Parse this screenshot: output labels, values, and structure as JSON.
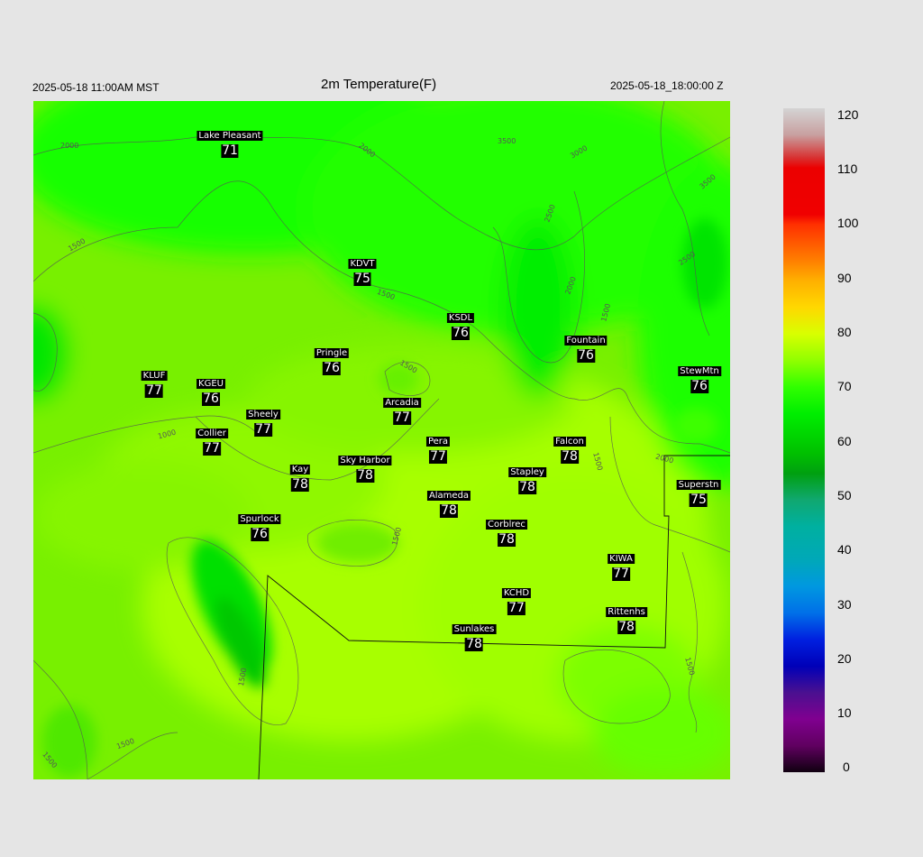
{
  "header": {
    "local_time": "2025-05-18 11:00AM MST",
    "title": "2m Temperature(F)",
    "utc_time": "2025-05-18_18:00:00 Z"
  },
  "stations": [
    {
      "name": "Lake Pleasant",
      "value": "71"
    },
    {
      "name": "KDVT",
      "value": "75"
    },
    {
      "name": "KSDL",
      "value": "76"
    },
    {
      "name": "Fountain",
      "value": "76"
    },
    {
      "name": "StewMtn",
      "value": "76"
    },
    {
      "name": "Pringle",
      "value": "76"
    },
    {
      "name": "KLUF",
      "value": "77"
    },
    {
      "name": "KGEU",
      "value": "76"
    },
    {
      "name": "Arcadia",
      "value": "77"
    },
    {
      "name": "Sheely",
      "value": "77"
    },
    {
      "name": "Collier",
      "value": "77"
    },
    {
      "name": "Pera",
      "value": "77"
    },
    {
      "name": "Falcon",
      "value": "78"
    },
    {
      "name": "Sky Harbor",
      "value": "78"
    },
    {
      "name": "Kay",
      "value": "78"
    },
    {
      "name": "Stapley",
      "value": "78"
    },
    {
      "name": "Superstn",
      "value": "75"
    },
    {
      "name": "Alameda",
      "value": "78"
    },
    {
      "name": "Spurlock",
      "value": "76"
    },
    {
      "name": "Corblrec",
      "value": "78"
    },
    {
      "name": "KIWA",
      "value": "77"
    },
    {
      "name": "KCHD",
      "value": "77"
    },
    {
      "name": "Rittenhs",
      "value": "78"
    },
    {
      "name": "Sunlakes",
      "value": "78"
    }
  ],
  "contour_labels": [
    "2000",
    "2000",
    "3500",
    "3000",
    "3500",
    "1500",
    "2500",
    "2000",
    "1500",
    "2500",
    "1500",
    "1500",
    "1000",
    "1500",
    "2000",
    "1500",
    "1500",
    "1500",
    "1500",
    "1500"
  ],
  "colorbar": {
    "ticks": [
      "120",
      "110",
      "100",
      "90",
      "80",
      "70",
      "60",
      "50",
      "40",
      "30",
      "20",
      "10",
      "0"
    ]
  }
}
